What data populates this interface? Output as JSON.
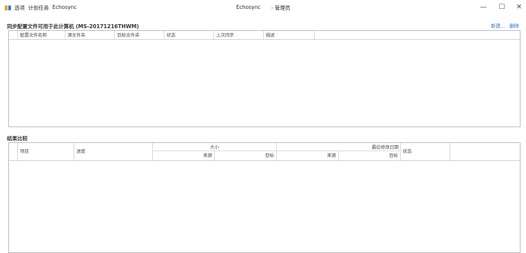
{
  "titlebar": {
    "menu_options": "选项",
    "menu_tasks": "计划任务",
    "menu_echosync": "Echosync",
    "app_name": "Echosync",
    "role": "- 管理员",
    "minimize": "—",
    "maximize": "☐",
    "close": "✕"
  },
  "configs": {
    "title": "同步配置文件可用于此计算机 (MS-20171216THWM)",
    "new_label": "新建...",
    "delete_label": "删除",
    "columns": [
      "配置文件名称",
      "源文件夹",
      "目标文件夹",
      "状态",
      "上次同步",
      "描述"
    ]
  },
  "results": {
    "title": "结果比较",
    "col_item": "项目",
    "col_progress": "进度",
    "group_size": "大小",
    "group_modified": "最后修改日期",
    "col_status": "状态",
    "sub_source_1": "来源",
    "sub_target_1": "目标",
    "sub_source_2": "来源",
    "sub_target_2": "目标"
  },
  "colors": {
    "accent": "#2a74c9",
    "border": "#b9b9b9"
  }
}
